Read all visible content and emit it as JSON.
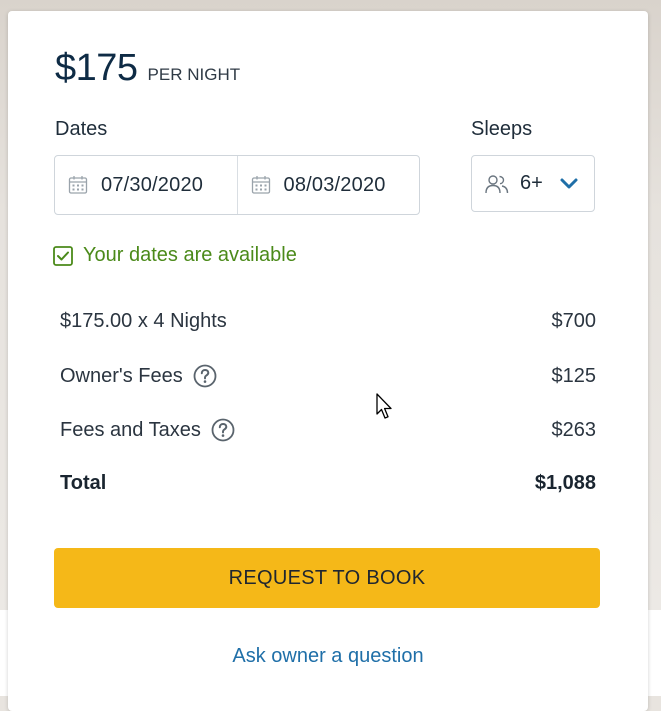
{
  "listing": {
    "price": "$175",
    "price_unit": "PER NIGHT"
  },
  "dates": {
    "label": "Dates",
    "check_in": "07/30/2020",
    "check_out": "08/03/2020",
    "icon": "calendar-icon"
  },
  "sleeps": {
    "label": "Sleeps",
    "value": "6+",
    "icon": "guests-icon"
  },
  "availability": {
    "text": "Your dates are available",
    "color": "#4b8a1a"
  },
  "breakdown": {
    "nights": {
      "label": "$175.00 x 4 Nights",
      "amount": "$700"
    },
    "owner_fees": {
      "label": "Owner's Fees",
      "amount": "$125"
    },
    "fees_taxes": {
      "label": "Fees and Taxes",
      "amount": "$263"
    },
    "total": {
      "label": "Total",
      "amount": "$1,088"
    }
  },
  "actions": {
    "book_label": "REQUEST TO BOOK",
    "book_color": "#f5b818",
    "ask_label": "Ask owner a question",
    "link_color": "#1f6fa8"
  }
}
